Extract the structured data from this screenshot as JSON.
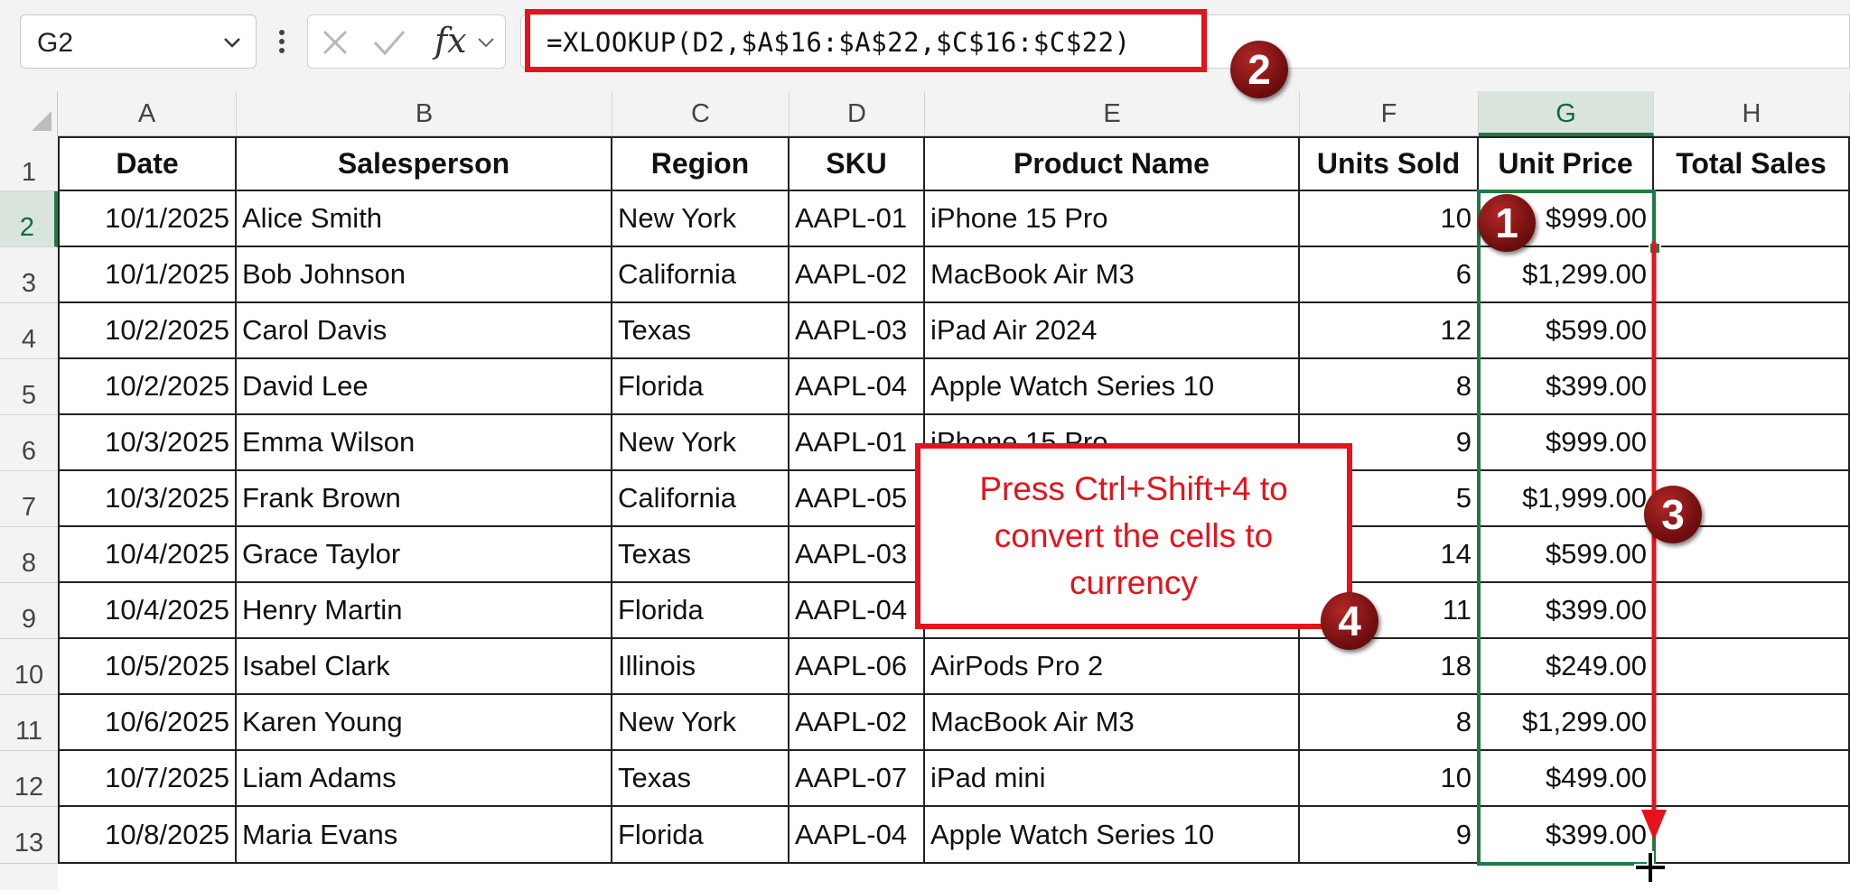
{
  "formula_bar": {
    "name_box": "G2",
    "fx_label": "fx",
    "formula": "=XLOOKUP(D2,$A$16:$A$22,$C$16:$C$22)"
  },
  "columns": [
    "A",
    "B",
    "C",
    "D",
    "E",
    "F",
    "G",
    "H"
  ],
  "rows": [
    "1",
    "2",
    "3",
    "4",
    "5",
    "6",
    "7",
    "8",
    "9",
    "10",
    "11",
    "12",
    "13"
  ],
  "selected_column": "G",
  "selected_row": "2",
  "table": {
    "headers": [
      "Date",
      "Salesperson",
      "Region",
      "SKU",
      "Product Name",
      "Units Sold",
      "Unit Price",
      "Total Sales"
    ],
    "rows": [
      [
        "10/1/2025",
        "Alice Smith",
        "New York",
        "AAPL-01",
        "iPhone 15 Pro",
        "10",
        "$999.00",
        ""
      ],
      [
        "10/1/2025",
        "Bob Johnson",
        "California",
        "AAPL-02",
        "MacBook Air M3",
        "6",
        "$1,299.00",
        ""
      ],
      [
        "10/2/2025",
        "Carol Davis",
        "Texas",
        "AAPL-03",
        "iPad Air 2024",
        "12",
        "$599.00",
        ""
      ],
      [
        "10/2/2025",
        "David Lee",
        "Florida",
        "AAPL-04",
        "Apple Watch Series 10",
        "8",
        "$399.00",
        ""
      ],
      [
        "10/3/2025",
        "Emma Wilson",
        "New York",
        "AAPL-01",
        "iPhone 15 Pro",
        "9",
        "$999.00",
        ""
      ],
      [
        "10/3/2025",
        "Frank Brown",
        "California",
        "AAPL-05",
        "",
        "5",
        "$1,999.00",
        ""
      ],
      [
        "10/4/2025",
        "Grace Taylor",
        "Texas",
        "AAPL-03",
        "",
        "14",
        "$599.00",
        ""
      ],
      [
        "10/4/2025",
        "Henry Martin",
        "Florida",
        "AAPL-04",
        "",
        "11",
        "$399.00",
        ""
      ],
      [
        "10/5/2025",
        "Isabel Clark",
        "Illinois",
        "AAPL-06",
        "AirPods Pro 2",
        "18",
        "$249.00",
        ""
      ],
      [
        "10/6/2025",
        "Karen Young",
        "New York",
        "AAPL-02",
        "MacBook Air M3",
        "8",
        "$1,299.00",
        ""
      ],
      [
        "10/7/2025",
        "Liam Adams",
        "Texas",
        "AAPL-07",
        "iPad mini",
        "10",
        "$499.00",
        ""
      ],
      [
        "10/8/2025",
        "Maria Evans",
        "Florida",
        "AAPL-04",
        "Apple Watch Series 10",
        "9",
        "$399.00",
        ""
      ]
    ]
  },
  "callout": {
    "text": "Press Ctrl+Shift+4 to convert the cells to currency"
  },
  "badges": [
    "1",
    "2",
    "3",
    "4"
  ],
  "colors": {
    "annotation_red": "#e5131c",
    "selection_green": "#1f7a44",
    "badge_dark_red": "#7a1010"
  }
}
